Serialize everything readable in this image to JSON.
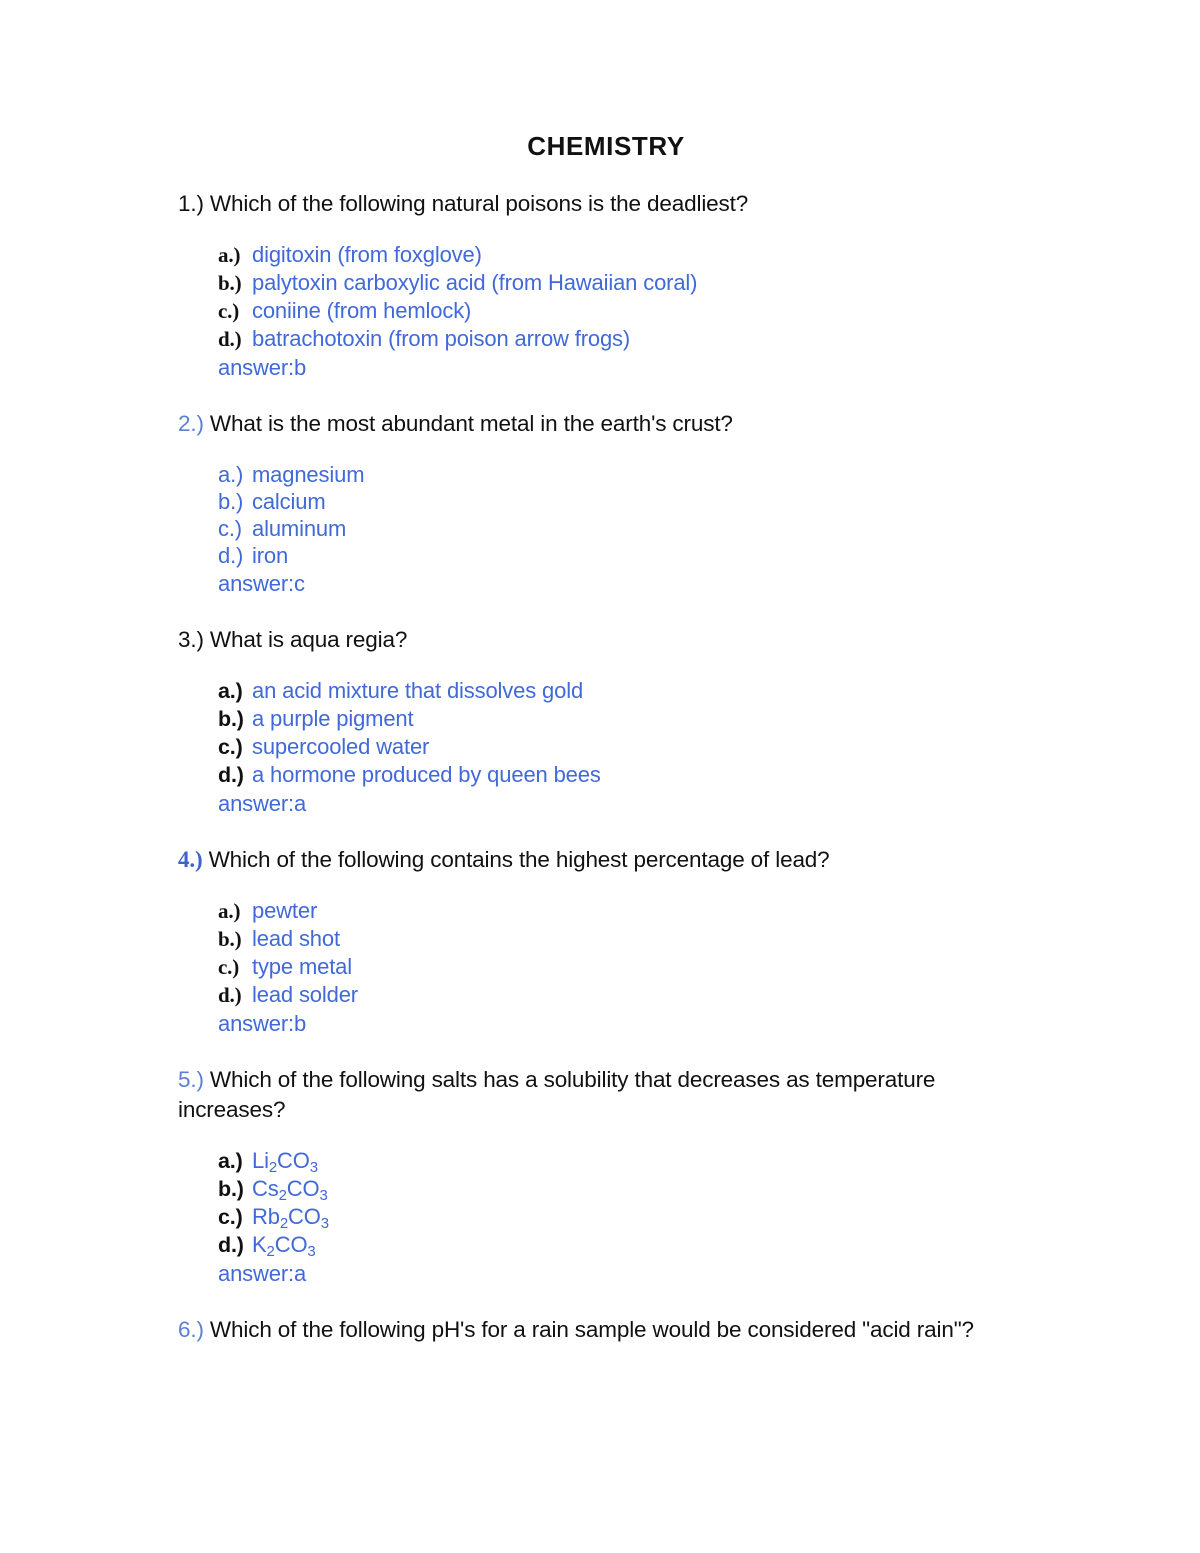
{
  "document": {
    "title": "CHEMISTRY"
  },
  "questions": [
    {
      "number": "1.)",
      "number_style": "black",
      "text": "Which of the following natural poisons is the deadliest?",
      "label_style": "serif",
      "options": [
        {
          "label": "a.)",
          "text": "digitoxin (from foxglove)"
        },
        {
          "label": "b.)",
          "text": "palytoxin carboxylic acid (from Hawaiian coral)"
        },
        {
          "label": "c.)",
          "text": "coniine (from hemlock)"
        },
        {
          "label": "d.)",
          "text": "batrachotoxin (from poison arrow frogs)"
        }
      ],
      "answer": "answer:b"
    },
    {
      "number": "2.)",
      "number_style": "blue",
      "text": "What is the most abundant metal in the earth's crust?",
      "label_style": "sans-blue",
      "options": [
        {
          "label": "a.)",
          "text": "magnesium"
        },
        {
          "label": "b.)",
          "text": "calcium"
        },
        {
          "label": "c.)",
          "text": "aluminum"
        },
        {
          "label": "d.)",
          "text": "iron"
        }
      ],
      "answer": "answer:c"
    },
    {
      "number": "3.)",
      "number_style": "black",
      "text": "What is aqua regia?",
      "label_style": "sans-black",
      "options": [
        {
          "label": "a.)",
          "text": "an acid mixture that dissolves gold"
        },
        {
          "label": "b.)",
          "text": "a purple pigment"
        },
        {
          "label": "c.)",
          "text": "supercooled water"
        },
        {
          "label": "d.)",
          "text": "a hormone produced by queen bees"
        }
      ],
      "answer": "answer:a"
    },
    {
      "number": "4.)",
      "number_style": "blue-strong",
      "text": "Which of the following contains the highest percentage of lead?",
      "label_style": "serif",
      "options": [
        {
          "label": "a.)",
          "text": "pewter"
        },
        {
          "label": "b.)",
          "text": "lead shot"
        },
        {
          "label": "c.)",
          "text": "type metal"
        },
        {
          "label": "d.)",
          "text": "lead solder"
        }
      ],
      "answer": "answer:b"
    },
    {
      "number": "5.)",
      "number_style": "blue",
      "text": "Which of the following salts has a solubility that decreases as temperature increases?",
      "label_style": "sans-black",
      "options": [
        {
          "label": "a.)",
          "html": "Li<sub>2</sub>CO<sub>3</sub>",
          "text": "Li2CO3"
        },
        {
          "label": "b.)",
          "html": "Cs<sub>2</sub>CO<sub>3</sub>",
          "text": "Cs2CO3"
        },
        {
          "label": "c.)",
          "html": "Rb<sub>2</sub>CO<sub>3</sub>",
          "text": "Rb2CO3"
        },
        {
          "label": "d.)",
          "html": "K<sub>2</sub>CO<sub>3</sub>",
          "text": "K2CO3"
        }
      ],
      "answer": "answer:a"
    },
    {
      "number": "6.)",
      "number_style": "blue",
      "text": "Which of the following pH's for a rain sample would be considered \"acid rain\"?",
      "label_style": "sans-black",
      "options": [],
      "answer": ""
    }
  ],
  "colors": {
    "option_blue": "#4169d8",
    "number_blue": "#5b7fd4",
    "number_blue_strong": "#3f62cf",
    "body_black": "#111111",
    "page_background": "#ffffff"
  }
}
